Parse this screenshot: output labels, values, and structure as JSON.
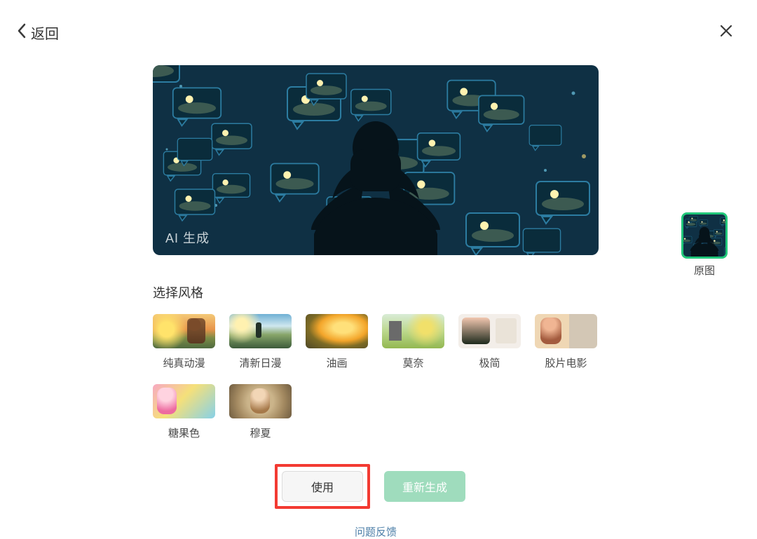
{
  "header": {
    "back_label": "返回"
  },
  "preview": {
    "ai_label": "AI 生成"
  },
  "original": {
    "label": "原图"
  },
  "style_section": {
    "title": "选择风格",
    "items": [
      {
        "id": "innocent-anime",
        "label": "纯真动漫",
        "swatch": "sw-a"
      },
      {
        "id": "fresh-jp-anime",
        "label": "清新日漫",
        "swatch": "sw-b"
      },
      {
        "id": "oil-painting",
        "label": "油画",
        "swatch": "sw-c"
      },
      {
        "id": "monet",
        "label": "莫奈",
        "swatch": "sw-d"
      },
      {
        "id": "minimal",
        "label": "极简",
        "swatch": "sw-e"
      },
      {
        "id": "film",
        "label": "胶片电影",
        "swatch": "sw-f"
      },
      {
        "id": "candy",
        "label": "糖果色",
        "swatch": "sw-g"
      },
      {
        "id": "mucha",
        "label": "穆夏",
        "swatch": "sw-h"
      }
    ]
  },
  "buttons": {
    "use": "使用",
    "regenerate": "重新生成"
  },
  "feedback": {
    "label": "问题反馈"
  },
  "colors": {
    "accent_green": "#21c77a",
    "highlight_red": "#f33a32",
    "regen_bg": "#9fdcbd"
  }
}
